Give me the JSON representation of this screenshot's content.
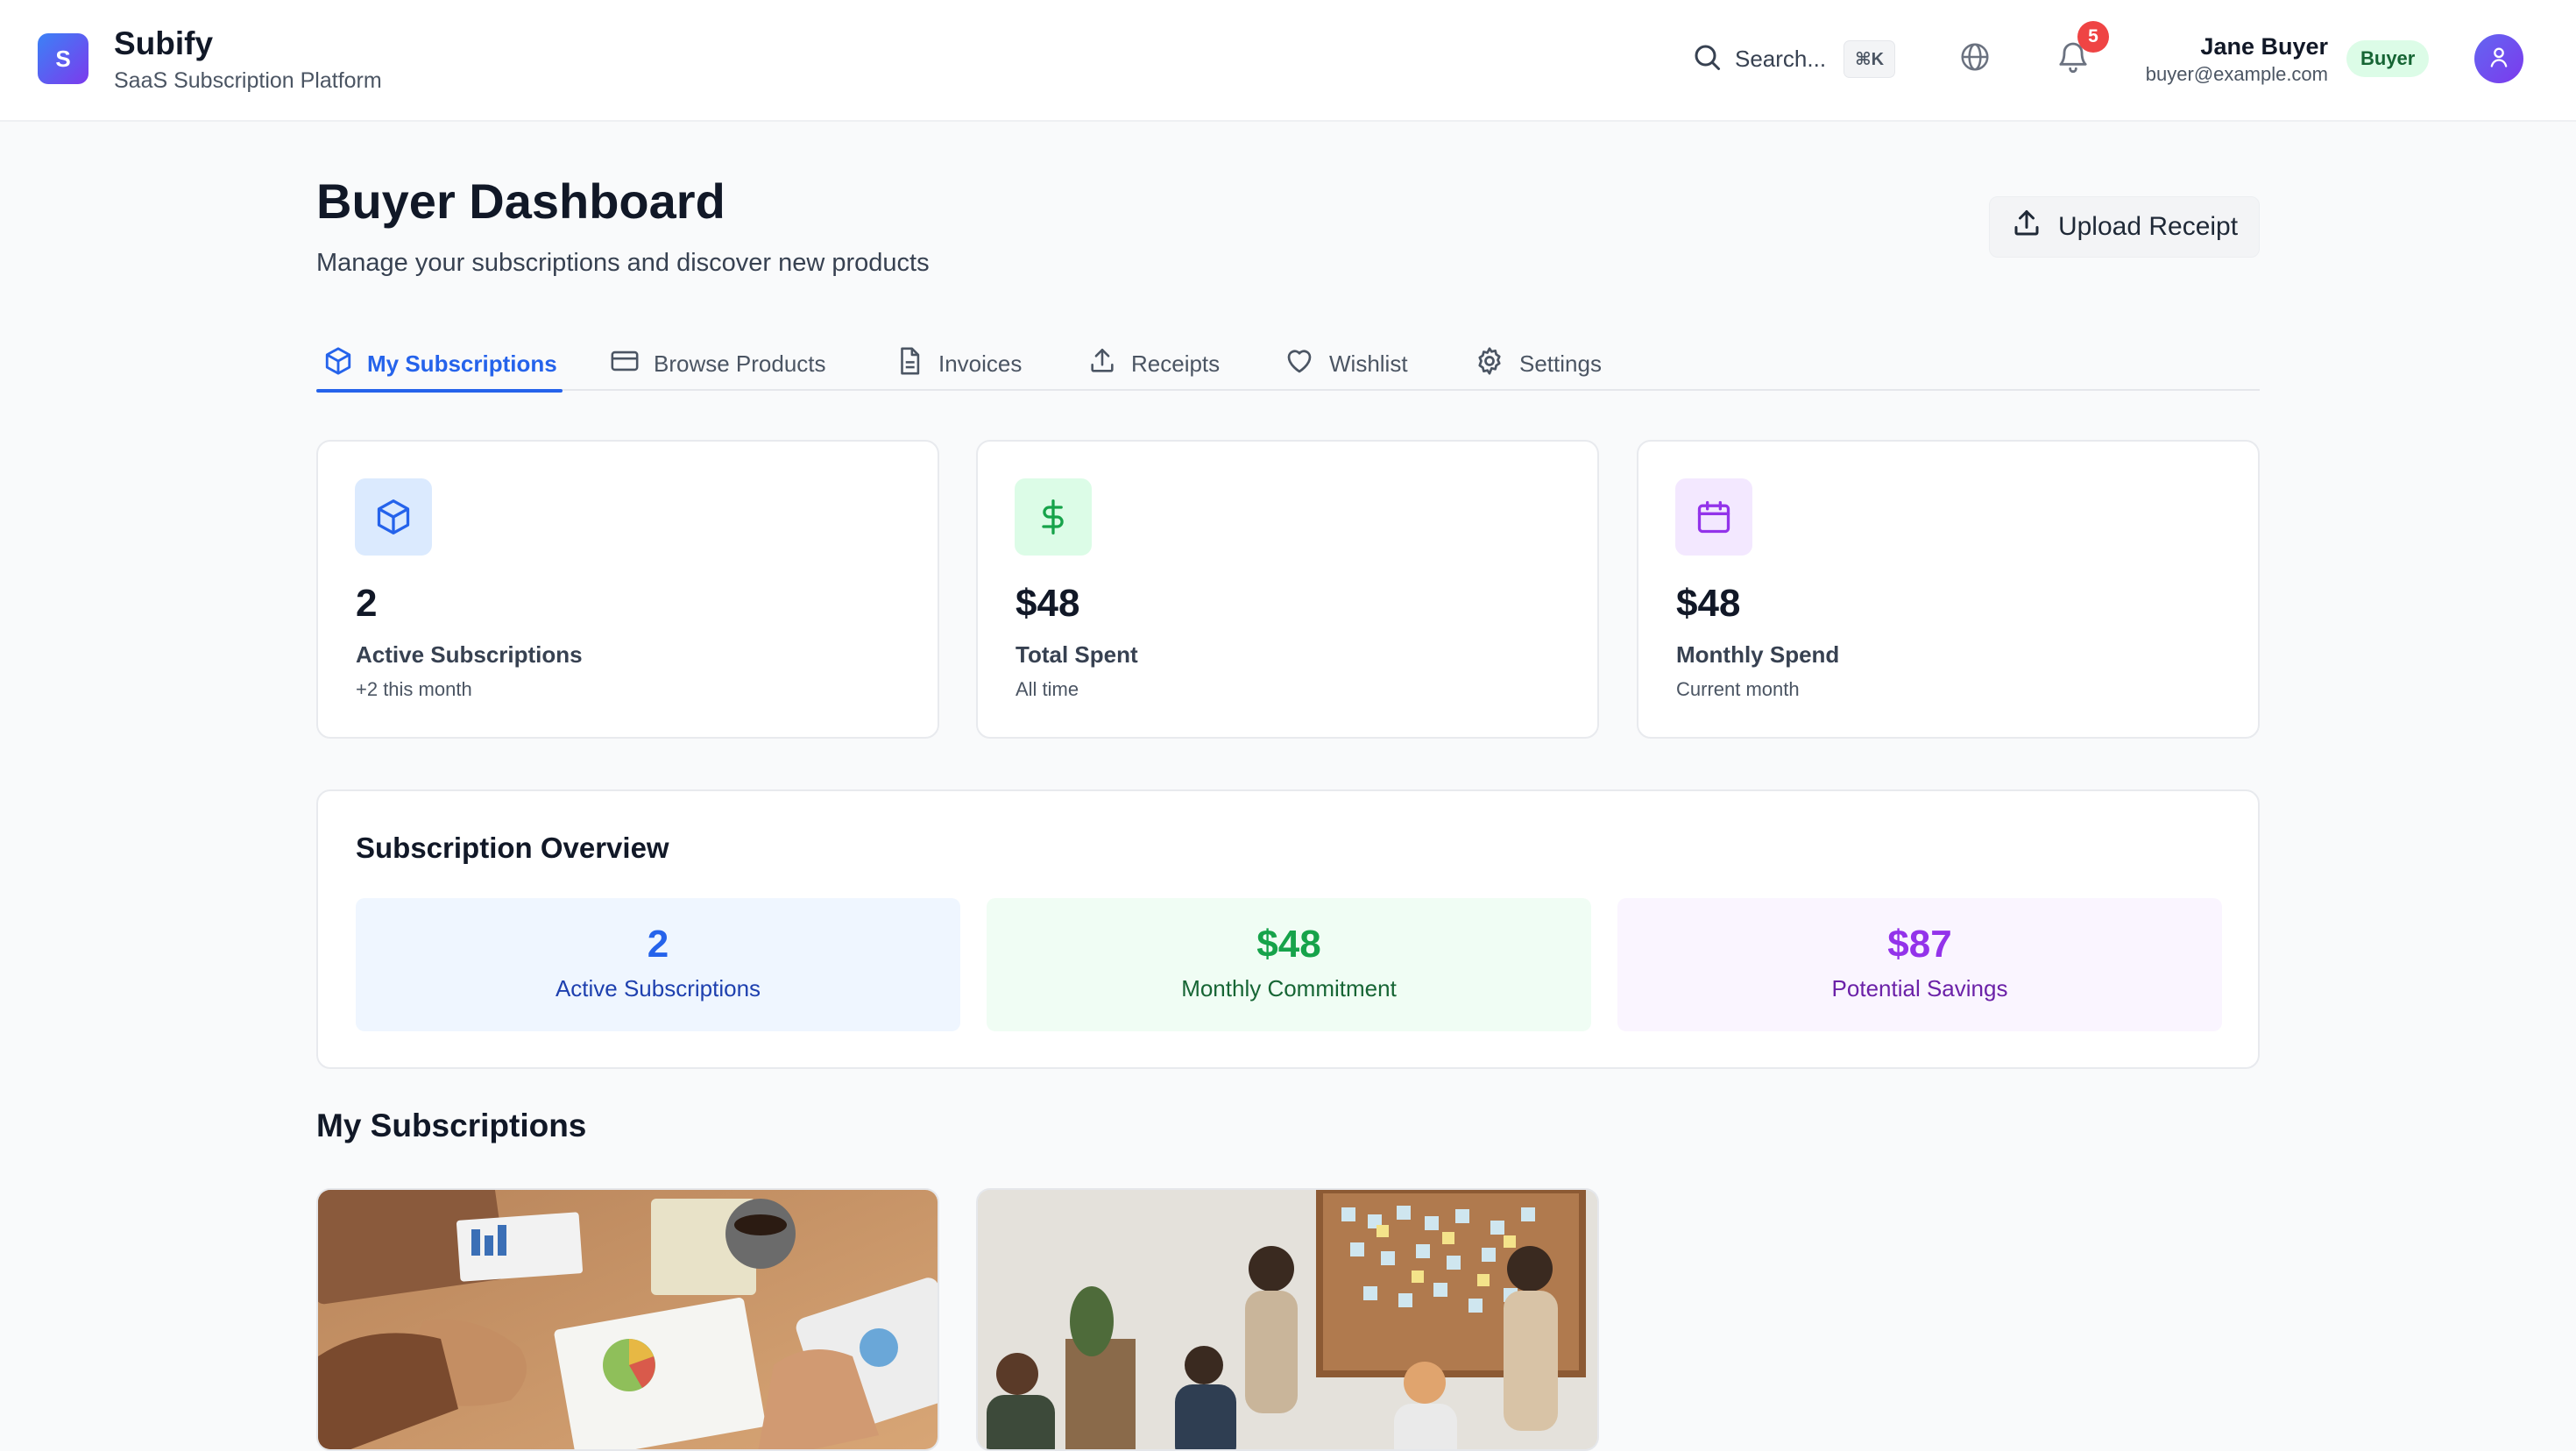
{
  "brand": {
    "logo_letter": "S",
    "name": "Subify",
    "tagline": "SaaS Subscription Platform"
  },
  "header": {
    "search_placeholder": "Search...",
    "search_shortcut": "⌘K",
    "notification_count": "5",
    "user": {
      "name": "Jane Buyer",
      "email": "buyer@example.com",
      "role": "Buyer"
    }
  },
  "page": {
    "title": "Buyer Dashboard",
    "subtitle": "Manage your subscriptions and discover new products",
    "upload_button": "Upload Receipt"
  },
  "tabs": [
    {
      "label": "My Subscriptions",
      "icon": "package-icon",
      "active": true
    },
    {
      "label": "Browse Products",
      "icon": "credit-card-icon",
      "active": false
    },
    {
      "label": "Invoices",
      "icon": "document-icon",
      "active": false
    },
    {
      "label": "Receipts",
      "icon": "upload-icon",
      "active": false
    },
    {
      "label": "Wishlist",
      "icon": "heart-icon",
      "active": false
    },
    {
      "label": "Settings",
      "icon": "gear-icon",
      "active": false
    }
  ],
  "stats": [
    {
      "value": "2",
      "label": "Active Subscriptions",
      "sub": "+2 this month",
      "icon": "package-icon",
      "color": "#2563eb",
      "bg": "#dbeafe"
    },
    {
      "value": "$48",
      "label": "Total Spent",
      "sub": "All time",
      "icon": "dollar-icon",
      "color": "#16a34a",
      "bg": "#dcfce7"
    },
    {
      "value": "$48",
      "label": "Monthly Spend",
      "sub": "Current month",
      "icon": "calendar-icon",
      "color": "#9333ea",
      "bg": "#f3e8ff"
    }
  ],
  "overview": {
    "title": "Subscription Overview",
    "items": [
      {
        "value": "2",
        "label": "Active Subscriptions",
        "color": "#2563eb",
        "label_color": "#1e40af",
        "bg": "#eff6ff"
      },
      {
        "value": "$48",
        "label": "Monthly Commitment",
        "color": "#16a34a",
        "label_color": "#166534",
        "bg": "#f0fdf4"
      },
      {
        "value": "$87",
        "label": "Potential Savings",
        "color": "#9333ea",
        "label_color": "#6b21a8",
        "bg": "#faf5ff"
      }
    ]
  },
  "subscriptions_section": {
    "title": "My Subscriptions"
  },
  "colors": {
    "accent": "#2563eb",
    "badge_red": "#ef4444"
  }
}
